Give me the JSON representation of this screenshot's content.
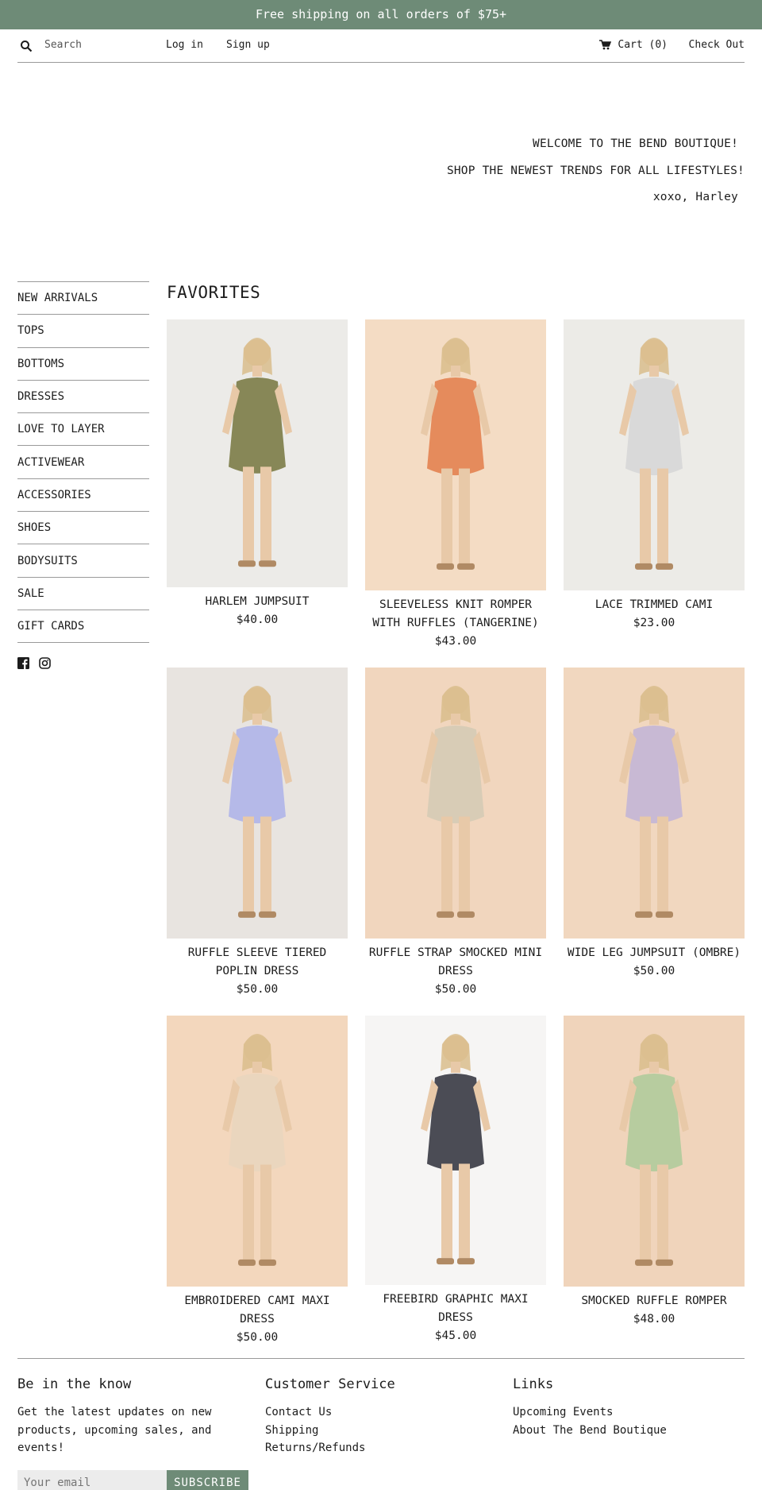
{
  "announcement": "Free shipping on all orders of $75+",
  "header": {
    "search_placeholder": "Search",
    "login": "Log in",
    "signup": "Sign up",
    "cart": "Cart (0)",
    "checkout": "Check Out"
  },
  "hero": {
    "line1": "WELCOME TO THE BEND BOUTIQUE!",
    "line2": "SHOP THE NEWEST TRENDS FOR ALL LIFESTYLES!",
    "line3": "xoxo, Harley"
  },
  "sidebar": {
    "items": [
      "NEW ARRIVALS",
      "TOPS",
      "BOTTOMS",
      "DRESSES",
      "LOVE TO LAYER",
      "ACTIVEWEAR",
      "ACCESSORIES",
      "SHOES",
      "BODYSUITS",
      "SALE",
      "GIFT CARDS"
    ],
    "social": [
      "facebook-icon",
      "instagram-icon"
    ]
  },
  "collection": {
    "heading": "FAVORITES",
    "products": [
      {
        "name": "HARLEM JUMPSUIT",
        "price": "$40.00",
        "bg": "#ecebe8",
        "outfit": "#878757"
      },
      {
        "name": "SLEEVELESS KNIT ROMPER WITH RUFFLES (TANGERINE)",
        "price": "$43.00",
        "bg": "#f4dcc4",
        "outfit": "#e58b5c"
      },
      {
        "name": "LACE TRIMMED CAMI",
        "price": "$23.00",
        "bg": "#ecebe7",
        "outfit": "#d9d9d9"
      },
      {
        "name": "RUFFLE SLEEVE TIERED POPLIN DRESS",
        "price": "$50.00",
        "bg": "#e8e4e0",
        "outfit": "#b5b9e8"
      },
      {
        "name": "RUFFLE STRAP SMOCKED MINI DRESS",
        "price": "$50.00",
        "bg": "#f1d6be",
        "outfit": "#d8ccb6"
      },
      {
        "name": "WIDE LEG JUMPSUIT (OMBRE)",
        "price": "$50.00",
        "bg": "#f1d7bf",
        "outfit": "#c8b9d4"
      },
      {
        "name": "EMBROIDERED CAMI MAXI DRESS",
        "price": "$50.00",
        "bg": "#f3d7bd",
        "outfit": "#ead6be"
      },
      {
        "name": "FREEBIRD GRAPHIC MAXI DRESS",
        "price": "$45.00",
        "bg": "#f6f5f4",
        "outfit": "#4b4c55"
      },
      {
        "name": "SMOCKED RUFFLE ROMPER",
        "price": "$48.00",
        "bg": "#f0d4bb",
        "outfit": "#b7cc9f"
      }
    ]
  },
  "footer": {
    "col1_title": "Be in the know",
    "col1_text": "Get the latest updates on new products, upcoming sales, and events!",
    "email_placeholder": "Your email",
    "subscribe": "SUBSCRIBE",
    "col2_title": "Customer Service",
    "col2_links": [
      "Contact Us",
      "Shipping",
      "Returns/Refunds"
    ],
    "col3_title": "Links",
    "col3_links": [
      "Upcoming Events",
      "About The Bend Boutique"
    ]
  },
  "colors": {
    "accent": "#6e8b77"
  }
}
